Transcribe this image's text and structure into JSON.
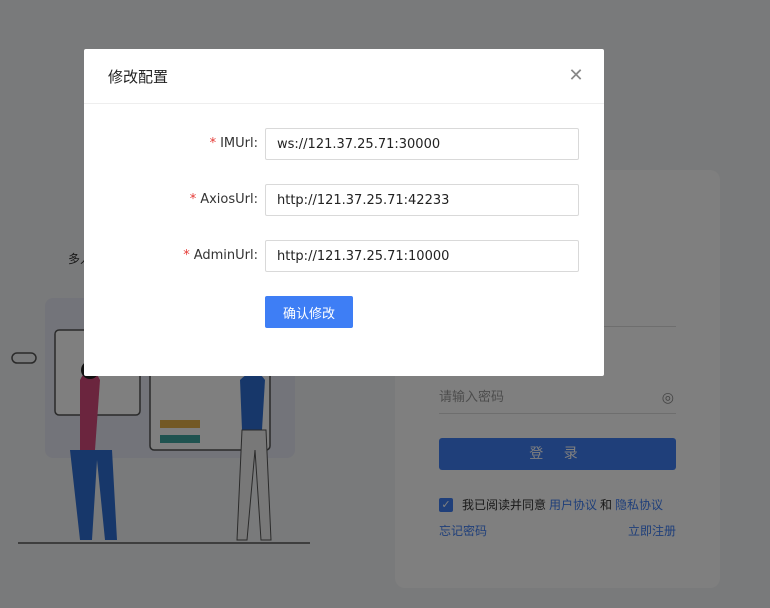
{
  "background": {
    "tagline": "多人",
    "login": {
      "password_placeholder": "请输入密码",
      "login_button": "登 录",
      "agree_prefix": "我已阅读并同意",
      "user_agreement": "用户协议",
      "and": "和",
      "privacy_policy": "隐私协议",
      "forgot_password": "忘记密码",
      "register": "立即注册"
    }
  },
  "modal": {
    "title": "修改配置",
    "fields": [
      {
        "label": "IMUrl",
        "value": "ws://121.37.25.71:30000"
      },
      {
        "label": "AxiosUrl",
        "value": "http://121.37.25.71:42233"
      },
      {
        "label": "AdminUrl",
        "value": "http://121.37.25.71:10000"
      }
    ],
    "required_mark": "*",
    "label_colon": ":",
    "confirm_button": "确认修改"
  },
  "colors": {
    "accent": "#3e7ef5",
    "required": "#e53935"
  }
}
